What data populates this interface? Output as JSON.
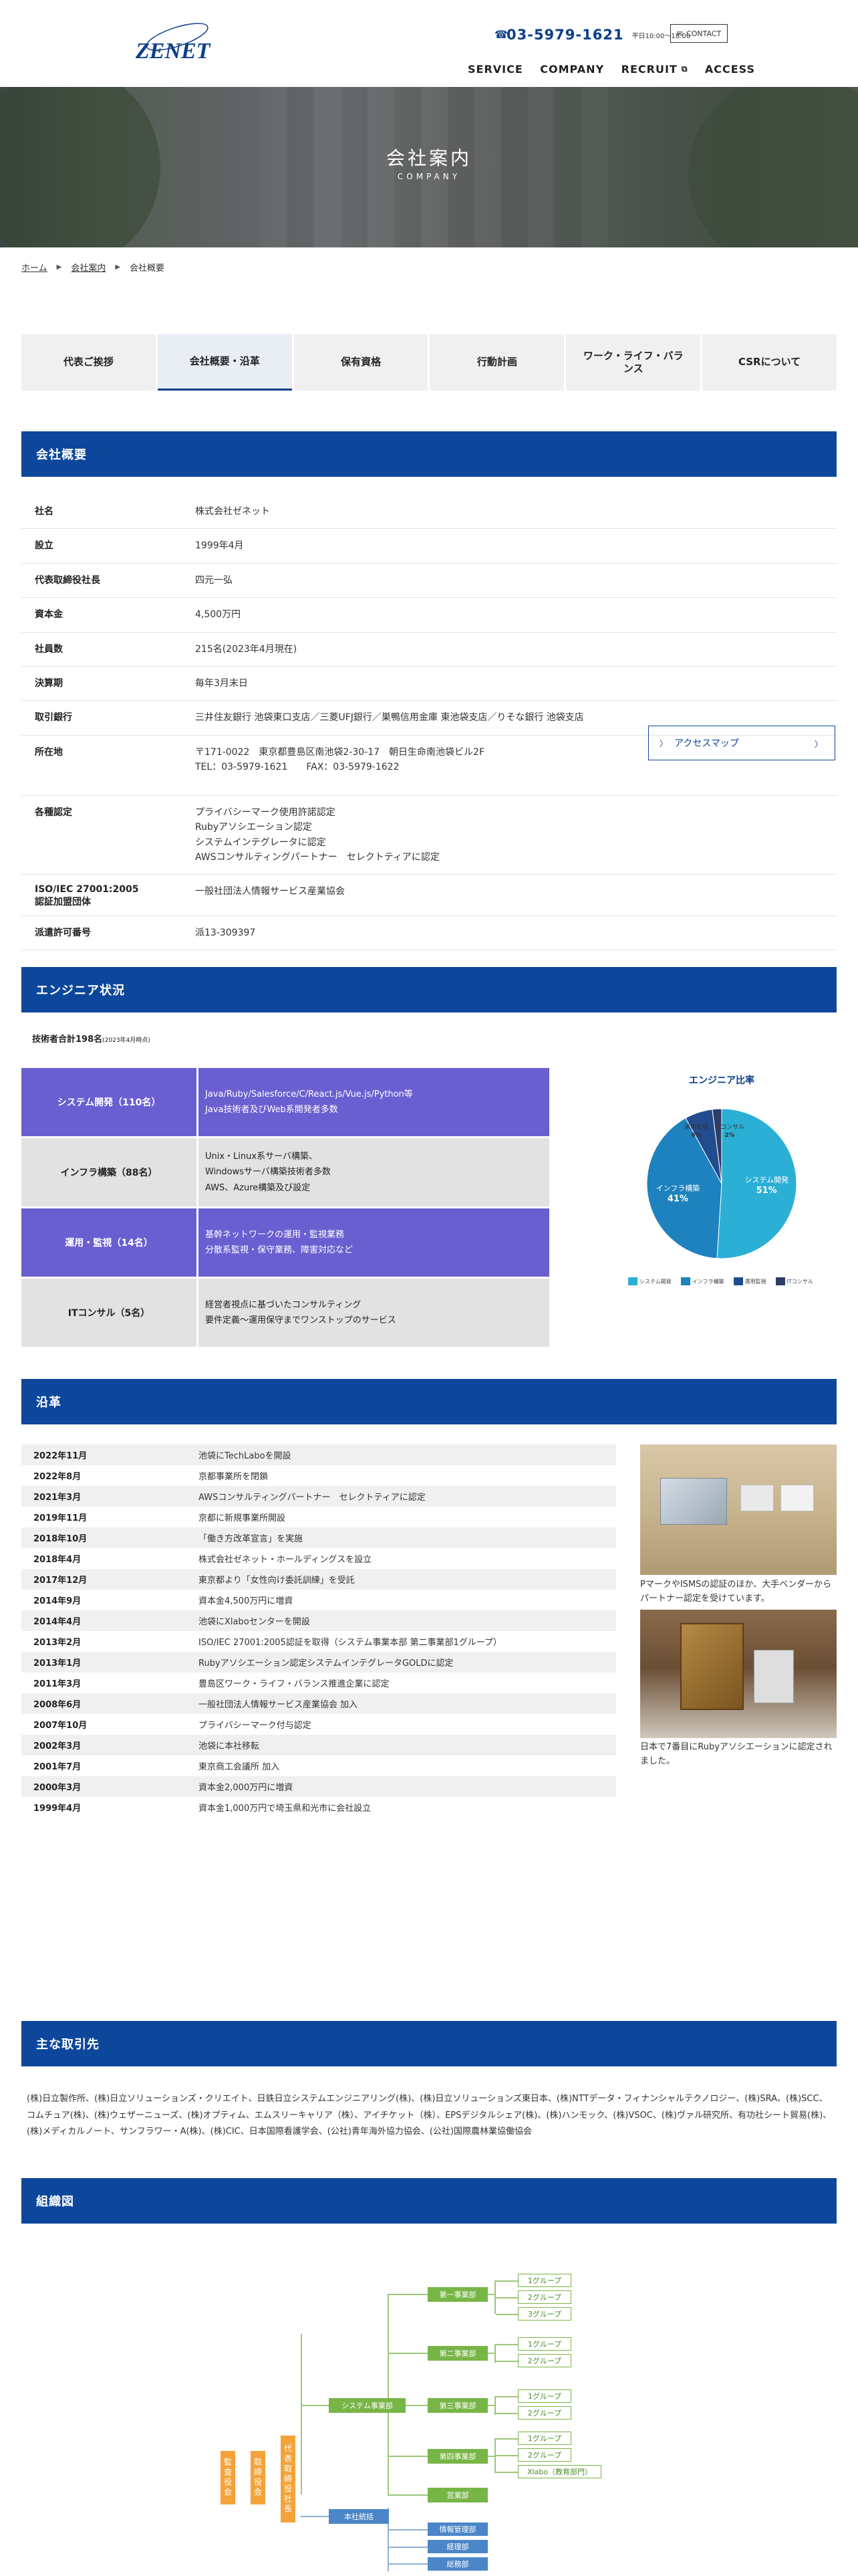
{
  "header": {
    "logo_text": "ZENET",
    "phone": "03-5979-1621",
    "hours": "平日10:00〜18:00",
    "contact": "CONTACT",
    "nav": [
      "SERVICE",
      "COMPANY",
      "RECRUIT",
      "ACCESS"
    ]
  },
  "hero": {
    "title": "会社案内",
    "subtitle": "COMPANY"
  },
  "breadcrumb": [
    "ホーム",
    "会社案内",
    "会社概要"
  ],
  "tabs": [
    "代表ご挨拶",
    "会社概要・沿革",
    "保有資格",
    "行動計画",
    "ワーク・ライフ・バランス",
    "CSRについて"
  ],
  "sections": {
    "overview": "会社概要",
    "engineers": "エンジニア状況",
    "history": "沿革",
    "clients": "主な取引先",
    "org": "組織図"
  },
  "company": [
    {
      "k": "社名",
      "v": [
        "株式会社ゼネット"
      ]
    },
    {
      "k": "設立",
      "v": [
        "1999年4月"
      ]
    },
    {
      "k": "代表取締役社長",
      "v": [
        "四元一弘"
      ]
    },
    {
      "k": "資本金",
      "v": [
        "4,500万円"
      ]
    },
    {
      "k": "社員数",
      "v": [
        "215名(2023年4月現在)"
      ]
    },
    {
      "k": "決算期",
      "v": [
        "毎年3月末日"
      ]
    },
    {
      "k": "取引銀行",
      "v": [
        "三井住友銀行 池袋東口支店／三菱UFJ銀行／巣鴨信用金庫 東池袋支店／りそな銀行 池袋支店"
      ]
    },
    {
      "k": "所在地",
      "v": [
        "〒171-0022　東京都豊島区南池袋2-30-17　朝日生命南池袋ビル2F",
        "TEL：03-5979-1621　　FAX：03-5979-1622"
      ]
    },
    {
      "k": "各種認定",
      "v": [
        "プライバシーマーク使用許諾認定",
        "Rubyアソシエーション認定",
        "システムインテグレータに認定",
        "AWSコンサルティングパートナー　セレクトティアに認定"
      ]
    },
    {
      "k": "ISO/IEC 27001:2005\n認証加盟団体",
      "v": [
        "一般社団法人情報サービス産業協会"
      ]
    },
    {
      "k": "派遣許可番号",
      "v": [
        "派13-309397"
      ]
    }
  ],
  "access_button": "アクセスマップ",
  "engineers": {
    "total": "技術者合計198名",
    "total_note": "(2023年4月時点)",
    "rows": [
      {
        "k": "システム開発（110名）",
        "v": [
          "Java/Ruby/Salesforce/C/React.js/Vue.js/Python等",
          "Java技術者及びWeb系開発者多数"
        ],
        "style": "dark"
      },
      {
        "k": "インフラ構築（88名）",
        "v": [
          "Unix・Linux系サーバ構築、",
          "Windowsサーバ構築技術者多数",
          "AWS、Azure構築及び設定"
        ],
        "style": "light"
      },
      {
        "k": "運用・監視（14名）",
        "v": [
          "基幹ネットワークの運用・監視業務",
          "分散系監視・保守業務、障害対応など"
        ],
        "style": "dark"
      },
      {
        "k": "ITコンサル（5名）",
        "v": [
          "経営者視点に基づいたコンサルティング",
          "要件定義〜運用保守までワンストップのサービス"
        ],
        "style": "light"
      }
    ]
  },
  "chart_data": {
    "type": "pie",
    "title": "エンジニア比率",
    "categories": [
      "システム開発",
      "インフラ構築",
      "運用監視",
      "ITコンサル"
    ],
    "values": [
      51,
      41,
      6,
      2
    ],
    "colors": [
      "#2bafd5",
      "#1d82bd",
      "#214d8e",
      "#2d3f66"
    ]
  },
  "history": [
    {
      "d": "2022年11月",
      "t": "池袋にTechLaboを開設"
    },
    {
      "d": "2022年8月",
      "t": "京都事業所を閉鎖"
    },
    {
      "d": "2021年3月",
      "t": "AWSコンサルティングパートナー　セレクトティアに認定"
    },
    {
      "d": "2019年11月",
      "t": "京都に新規事業所開設"
    },
    {
      "d": "2018年10月",
      "t": "「働き方改革宣言」を実施"
    },
    {
      "d": "2018年4月",
      "t": "株式会社ゼネット・ホールディングスを設立"
    },
    {
      "d": "2017年12月",
      "t": "東京都より「女性向け委託訓練」を受託"
    },
    {
      "d": "2014年9月",
      "t": "資本金4,500万円に増資"
    },
    {
      "d": "2014年4月",
      "t": "池袋にXlaboセンターを開設"
    },
    {
      "d": "2013年2月",
      "t": "ISO/IEC 27001:2005認証を取得（システム事業本部 第二事業部1グループ）"
    },
    {
      "d": "2013年1月",
      "t": "Rubyアソシエーション認定システムインテグレータGOLDに認定"
    },
    {
      "d": "2011年3月",
      "t": "豊島区ワーク・ライフ・バランス推進企業に認定"
    },
    {
      "d": "2008年6月",
      "t": "一般社団法人情報サービス産業協会 加入"
    },
    {
      "d": "2007年10月",
      "t": "プライバシーマーク付与認定"
    },
    {
      "d": "2002年3月",
      "t": "池袋に本社移転"
    },
    {
      "d": "2001年7月",
      "t": "東京商工会議所 加入"
    },
    {
      "d": "2000年3月",
      "t": "資本金2,000万円に増資"
    },
    {
      "d": "1999年4月",
      "t": "資本金1,000万円で埼玉県和光市に会社設立"
    }
  ],
  "history_captions": [
    "PマークやISMSの認証のほか、大手ベンダーからパートナー認定を受けています。",
    "日本で7番目にRubyアソシエーションに認定されました。"
  ],
  "clients_text": "(株)日立製作所、(株)日立ソリューションズ・クリエイト、日鉄日立システムエンジニアリング(株)、(株)日立ソリューションズ東日本、(株)NTTデータ・フィナンシャルテクノロジー、(株)SRA、(株)SCC、コムチュア(株)、(株)ウェザーニューズ、(株)オプティム、エムスリーキャリア（株）、アイチケット（株）、EPSデジタルシェア(株)、(株)ハンモック、(株)VSOC、(株)ヴァル研究所、有功社シート貿易(株)、(株)メディカルノート、サンフラワー・A(株)、(株)CIC、日本国際看護学会、(公社)青年海外協力協会、(公社)国際農林業協働協会",
  "org": {
    "top": [
      "監査役会",
      "取締役会",
      "代表取締役社長"
    ],
    "system": "システム事業部",
    "honbu": "本社統括",
    "divisions": [
      "第一事業部",
      "第二事業部",
      "第三事業部",
      "第四事業部",
      "営業部"
    ],
    "groups": [
      [
        "1グループ",
        "2グループ",
        "3グループ"
      ],
      [
        "1グループ",
        "2グループ"
      ],
      [
        "1グループ",
        "2グループ"
      ],
      [
        "1グループ",
        "2グループ",
        "Xlabo（教育部門）"
      ]
    ],
    "honbu_units": [
      "情報管理部",
      "経理部",
      "総務部"
    ]
  }
}
